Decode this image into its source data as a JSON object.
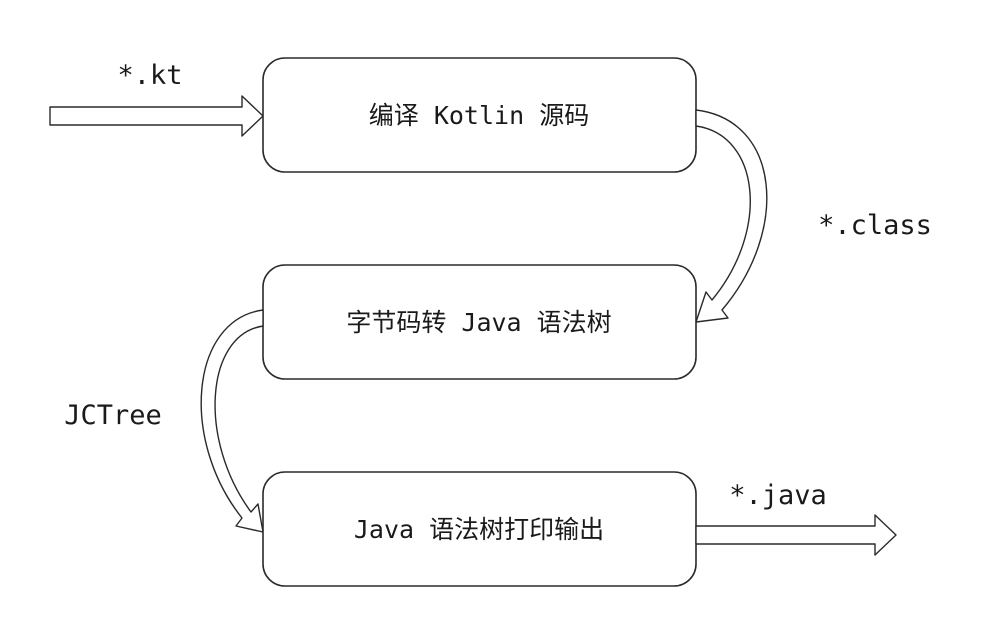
{
  "diagram": {
    "steps": [
      {
        "label": "编译 Kotlin 源码"
      },
      {
        "label": "字节码转 Java 语法树"
      },
      {
        "label": "Java 语法树打印输出"
      }
    ],
    "edges": [
      {
        "label": "*.kt"
      },
      {
        "label": "*.class"
      },
      {
        "label": "JCTree"
      },
      {
        "label": "*.java"
      }
    ]
  }
}
